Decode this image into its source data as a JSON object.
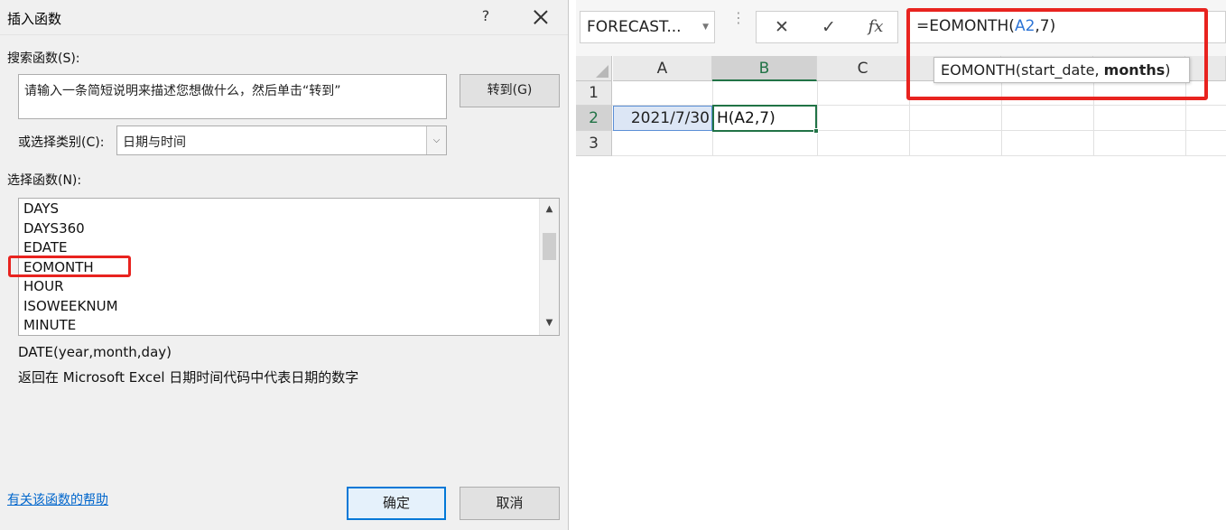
{
  "dialog": {
    "title": "插入函数",
    "help_symbol": "?",
    "search_label": "搜索函数(S):",
    "search_text": "请输入一条简短说明来描述您想做什么，然后单击“转到”",
    "goto_label": "转到(G)",
    "category_label": "或选择类别(C):",
    "category_value": "日期与时间",
    "select_function_label": "选择函数(N):",
    "functions": [
      "DAYS",
      "DAYS360",
      "EDATE",
      "EOMONTH",
      "HOUR",
      "ISOWEEKNUM",
      "MINUTE"
    ],
    "signature": "DATE(year,month,day)",
    "description": "返回在 Microsoft Excel 日期时间代码中代表日期的数字",
    "help_link": "有关该函数的帮助",
    "ok_label": "确定",
    "cancel_label": "取消"
  },
  "excel": {
    "name_box": "FORECAST...",
    "formula_prefix": "=EOMONTH(",
    "formula_ref": "A2",
    "formula_suffix": ",7)",
    "tooltip_fn": "EOMONTH(start_date, ",
    "tooltip_bold": "months",
    "tooltip_close": ")",
    "columns": [
      "A",
      "B",
      "C"
    ],
    "rows": [
      "1",
      "2",
      "3"
    ],
    "cell_a2": "2021/7/30",
    "cell_b2": "H(A2,7)"
  },
  "colors": {
    "highlight_red": "#e8231f",
    "excel_green": "#217346",
    "ref_blue": "#2e75d6",
    "link_blue": "#0066cc"
  }
}
